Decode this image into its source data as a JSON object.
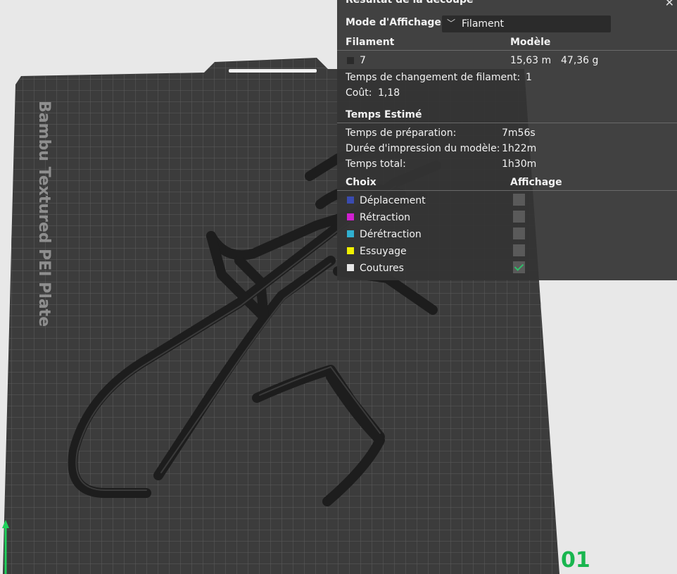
{
  "plate": {
    "label": "Bambu Textured PEI Plate",
    "plate_number": "01",
    "colors": {
      "plate": "#3c3c3c",
      "grid": "#5a5a5a",
      "filament": "#1d1d1d",
      "axis": "#1fd15c",
      "number": "#19b64f"
    }
  },
  "panel": {
    "title": "Résultat de la découpe",
    "mode_label": "Mode d'Affichage",
    "mode_value": "Filament",
    "filament_table": {
      "col_filament": "Filament",
      "col_model": "Modèle",
      "row": {
        "id": "7",
        "length": "15,63 m",
        "weight": "47,36 g",
        "color": "#2a2a2a"
      }
    },
    "change_time_label": "Temps de changement de filament:",
    "change_time_value": "1",
    "cost_label": "Coût:",
    "cost_value": "1,18",
    "estimated_header": "Temps Estimé",
    "prep_label": "Temps de préparation:",
    "prep_value": "7m56s",
    "print_label": "Durée d'impression du modèle:",
    "print_value": "1h22m",
    "total_label": "Temps total:",
    "total_value": "1h30m",
    "options_header": "Choix",
    "display_header": "Affichage",
    "options": [
      {
        "label": "Déplacement",
        "color": "#3a4bb0",
        "checked": false
      },
      {
        "label": "Rétraction",
        "color": "#d020d0",
        "checked": false
      },
      {
        "label": "Dérétraction",
        "color": "#30b0d0",
        "checked": false
      },
      {
        "label": "Essuyage",
        "color": "#f0f000",
        "checked": false
      },
      {
        "label": "Coutures",
        "color": "#e8e8e8",
        "checked": true
      }
    ]
  }
}
